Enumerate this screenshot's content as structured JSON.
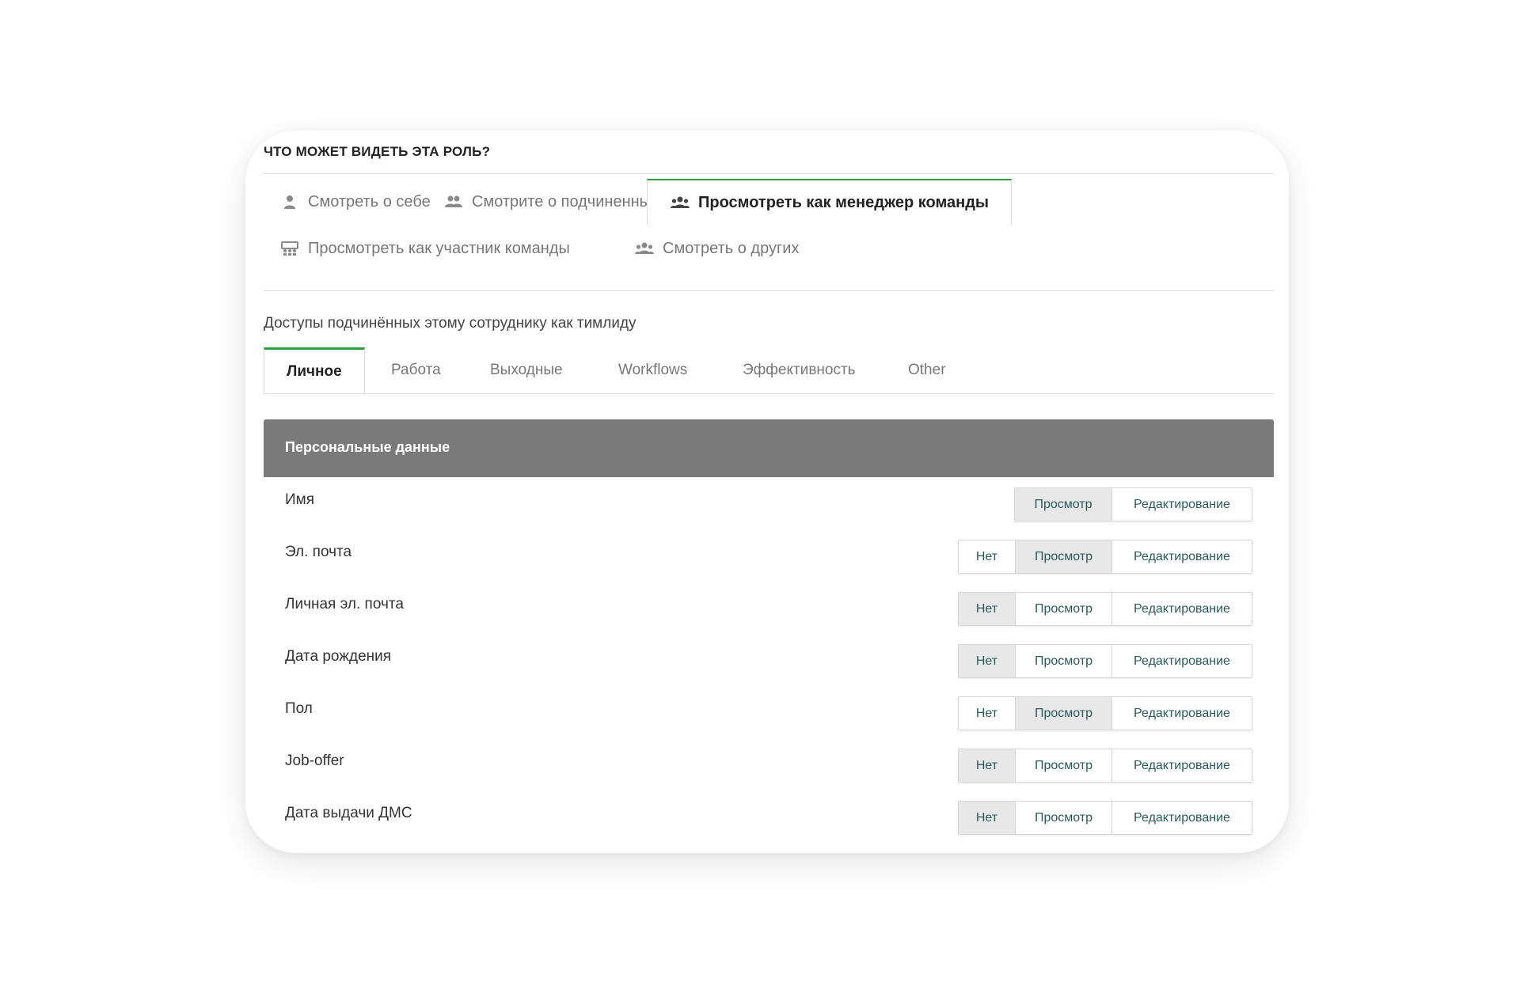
{
  "section_title": "ЧТО МОЖЕТ ВИДЕТЬ ЭТА РОЛЬ?",
  "role_tabs": [
    {
      "label": "Смотреть о себе",
      "icon": "user-icon"
    },
    {
      "label": "Смотрите о подчиненных",
      "icon": "users-icon"
    },
    {
      "label": "Просмотреть как менеджер команды",
      "icon": "group-icon",
      "active": true
    },
    {
      "label": "Просмотреть как участник команды",
      "icon": "team-board-icon"
    },
    {
      "label": "Смотреть о других",
      "icon": "group-icon"
    }
  ],
  "subordinates_desc": "Доступы подчинённых этому сотруднику как тимлиду",
  "sub_tabs": [
    {
      "label": "Личное",
      "active": true
    },
    {
      "label": "Работа"
    },
    {
      "label": "Выходные"
    },
    {
      "label": "Workflows"
    },
    {
      "label": "Эффективность"
    },
    {
      "label": "Other"
    }
  ],
  "panel_title": "Персональные данные",
  "options": {
    "none": "Нет",
    "view": "Просмотр",
    "edit": "Редактирование"
  },
  "rows": [
    {
      "label": "Имя",
      "selected": "view"
    },
    {
      "label": "Эл. почта",
      "selected": "view"
    },
    {
      "label": "Личная эл. почта",
      "selected": "none"
    },
    {
      "label": "Дата рождения",
      "selected": "none"
    },
    {
      "label": "Пол",
      "selected": "view"
    },
    {
      "label": "Job-offer",
      "selected": "none"
    },
    {
      "label": "Дата выдачи ДМС",
      "selected": "none"
    }
  ],
  "colors": {
    "accent": "#2e9e3e",
    "panel_header": "#7a7a7a",
    "selected_option": "#e8e8e8"
  }
}
